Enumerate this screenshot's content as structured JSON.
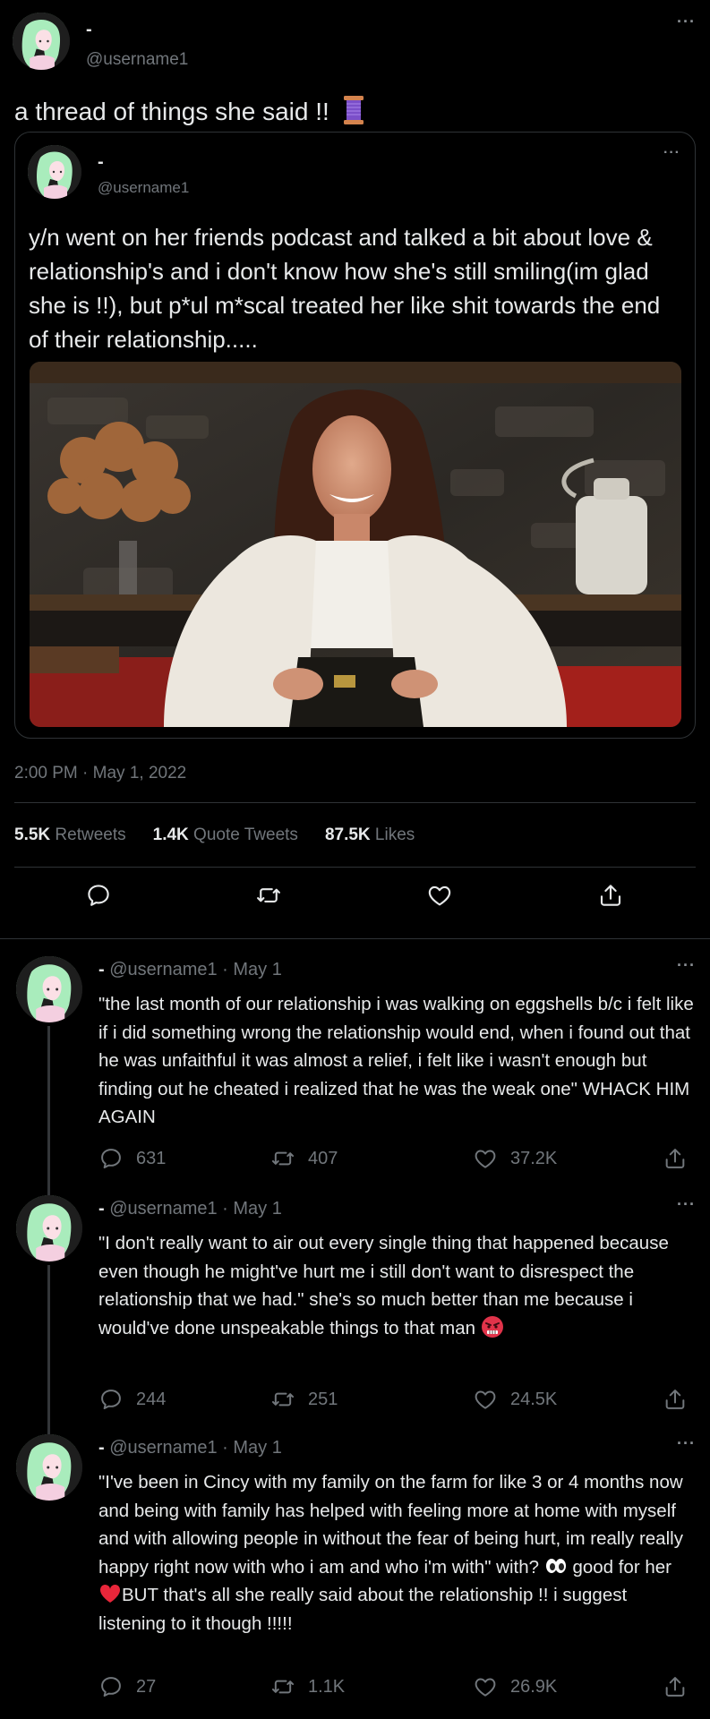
{
  "main_tweet": {
    "author_name": "-",
    "author_handle": "@username1",
    "text": "a thread of things she said !!",
    "quote": {
      "author_name": "-",
      "author_handle": "@username1",
      "text": "y/n went on her friends podcast and talked a bit about love & relationship's and i don't know how she's still smiling(im glad she is !!), but p*ul m*scal treated her like shit towards the end of their relationship....."
    },
    "timestamp": "2:00 PM · May 1, 2022",
    "stats": {
      "retweets_count": "5.5K",
      "retweets_label": "Retweets",
      "quotes_count": "1.4K",
      "quotes_label": "Quote Tweets",
      "likes_count": "87.5K",
      "likes_label": "Likes"
    }
  },
  "replies": [
    {
      "author_name": "-",
      "handle_date": "@username1 · May 1",
      "text": "\"the last month of our relationship i was walking on eggshells b/c i felt like if i did something wrong the relationship would end, when i found out that he was unfaithful it was almost a relief, i felt like i wasn't enough but finding out he cheated i realized that he was the weak one\" WHACK HIM AGAIN",
      "replies": "631",
      "retweets": "407",
      "likes": "37.2K"
    },
    {
      "author_name": "-",
      "handle_date": "@username1 · May 1",
      "text": "\"I don't really want to air out every single thing that happened because even though he might've hurt me i still don't want to disrespect the relationship that we had.\" she's so much better than me because i would've done unspeakable things to that man",
      "replies": "244",
      "retweets": "251",
      "likes": "24.5K"
    },
    {
      "author_name": "-",
      "handle_date": "@username1 · May 1",
      "text_part1": "\"I've been in Cincy with my family on the farm for like 3 or 4 months now  and being with family has helped with feeling more at home with myself and with allowing people in without the fear of being hurt, im really really happy right now with who i am and who i'm with\" with?",
      "text_part2": "good for her",
      "text_part3": "BUT that's all she really said about the relationship !! i suggest listening to it though !!!!!",
      "replies": "27",
      "retweets": "1.1K",
      "likes": "26.9K"
    }
  ],
  "icons": [
    "spool-emoji",
    "reply-icon",
    "retweet-icon",
    "like-icon",
    "share-icon",
    "more-icon",
    "angry-emoji",
    "eyes-emoji",
    "red-heart-emoji"
  ],
  "colors": {
    "background": "#000000",
    "text": "#e7e9ea",
    "muted": "#71767b",
    "border": "#2f3336"
  }
}
